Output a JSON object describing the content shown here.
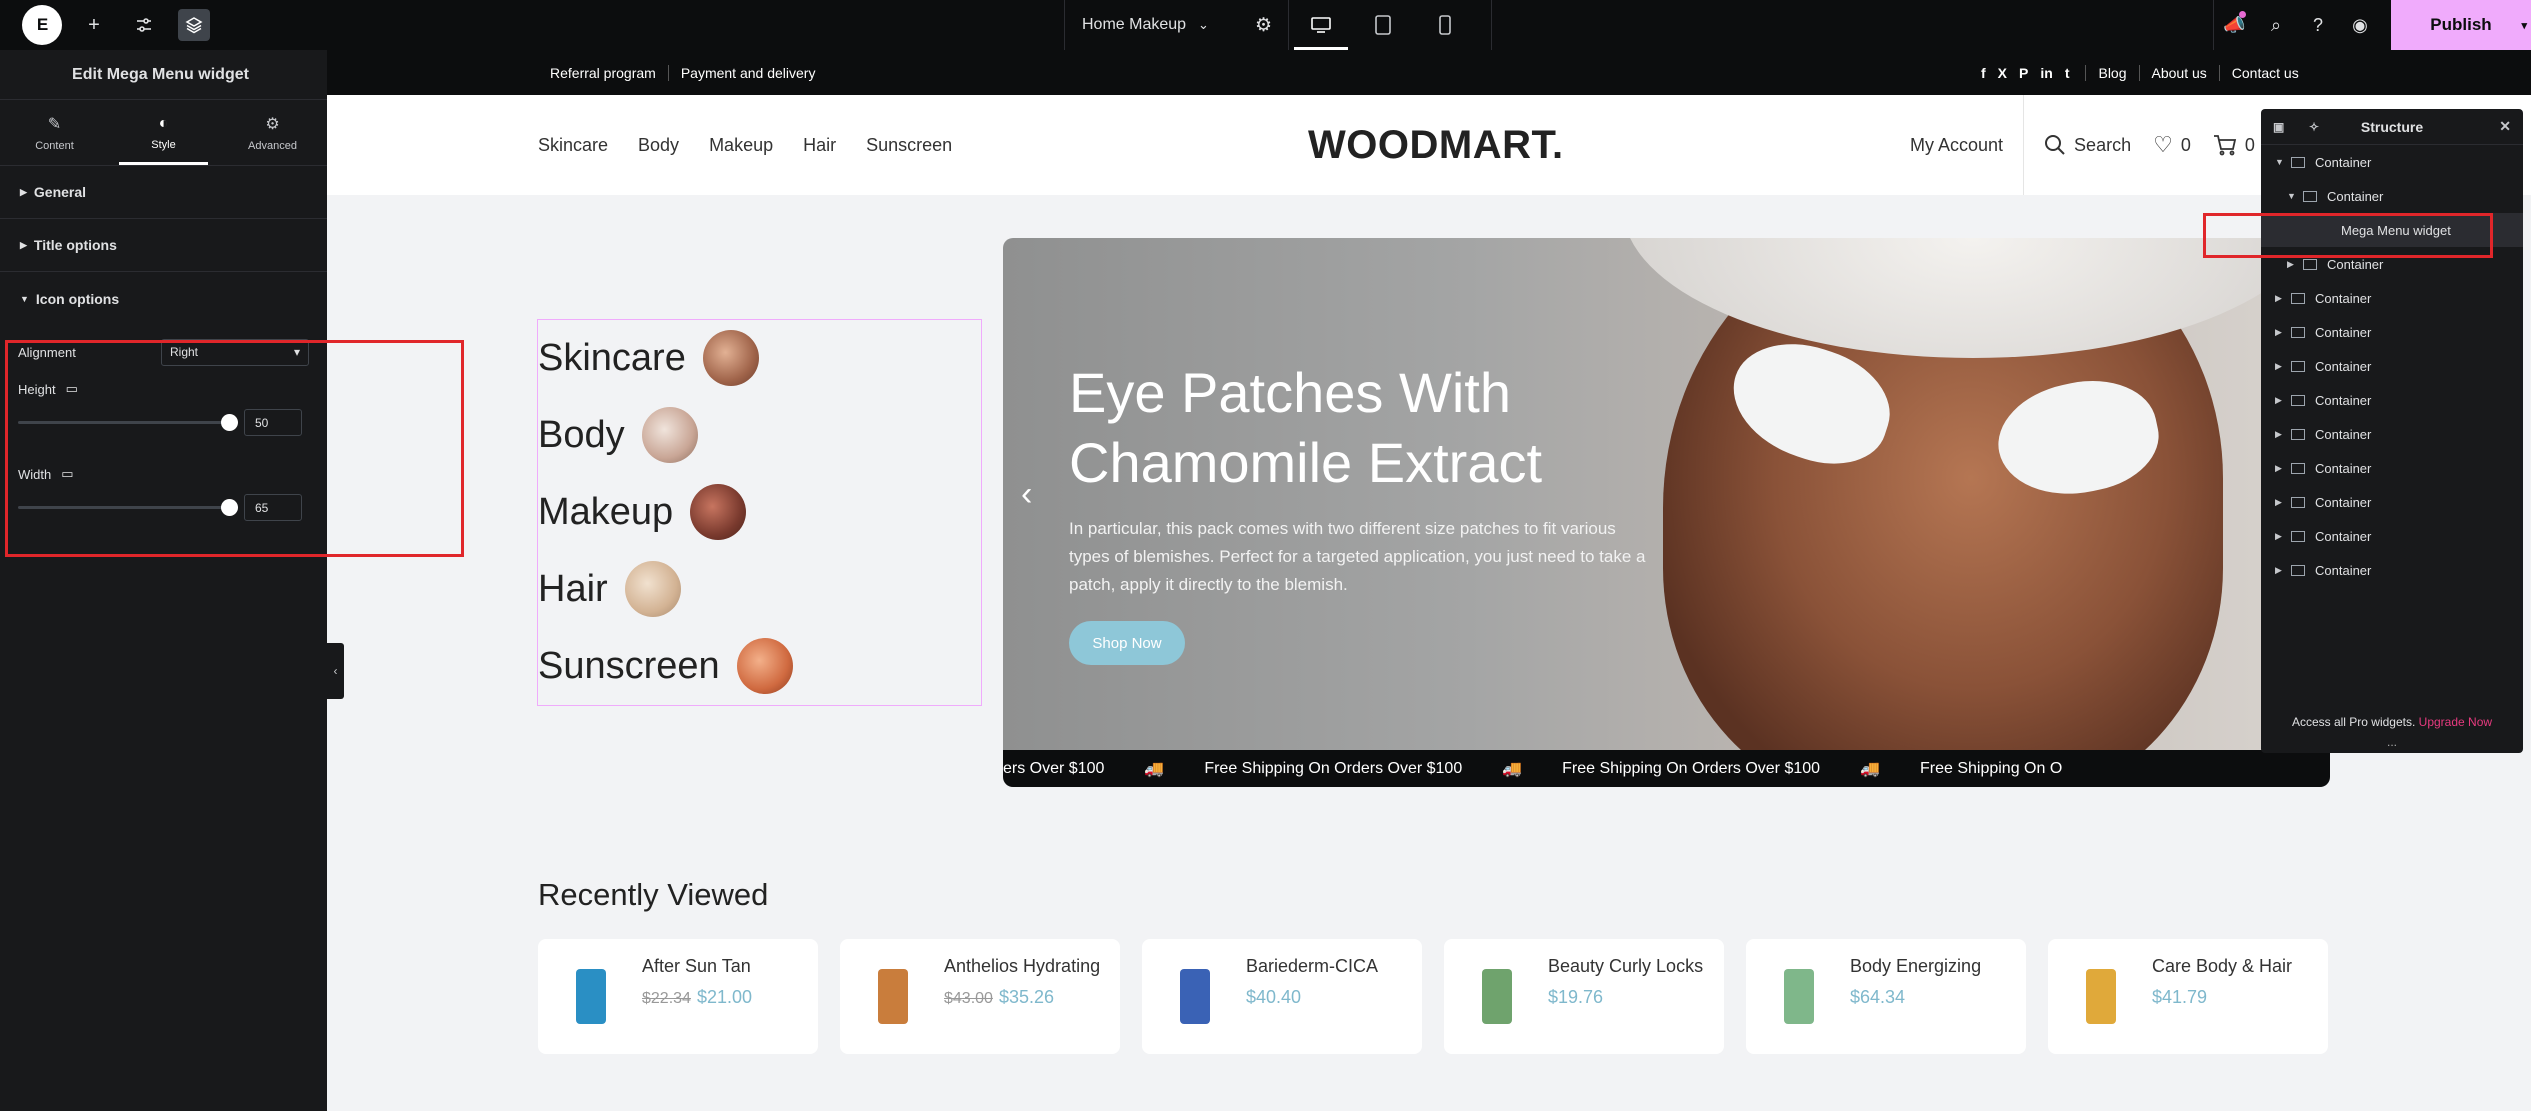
{
  "toolbar": {
    "logo_text": "E",
    "page_name": "Home Makeup",
    "publish_label": "Publish"
  },
  "panel": {
    "title": "Edit Mega Menu widget",
    "tabs": [
      {
        "label": "Content",
        "icon": "pencil-icon"
      },
      {
        "label": "Style",
        "icon": "contrast-icon"
      },
      {
        "label": "Advanced",
        "icon": "gear-icon"
      }
    ],
    "sections": {
      "general": "General",
      "title_options": "Title options",
      "icon_options": "Icon options"
    },
    "alignment_label": "Alignment",
    "alignment_value": "Right",
    "height_label": "Height",
    "height_value": "50",
    "width_label": "Width",
    "width_value": "65"
  },
  "site": {
    "topnav": {
      "left": [
        "Referral program",
        "Payment and delivery"
      ],
      "social": [
        "f",
        "X",
        "P",
        "in",
        "t"
      ],
      "right": [
        "Blog",
        "About us",
        "Contact us"
      ]
    },
    "mainnav": [
      "Skincare",
      "Body",
      "Makeup",
      "Hair",
      "Sunscreen"
    ],
    "brand": "WOODMART.",
    "account_label": "My Account",
    "search_label": "Search",
    "wishlist_count": "0",
    "cart_count": "0",
    "vmenu": [
      "Skincare",
      "Body",
      "Makeup",
      "Hair",
      "Sunscreen"
    ],
    "hero": {
      "title": "Eye Patches With Chamomile Extract",
      "text": "In particular, this pack comes with two different size patches to fit various types of blemishes. Perfect for a targeted application, you just need to take a patch, apply it directly to the blemish.",
      "button": "Shop Now"
    },
    "ticker": [
      "ers Over $100",
      "Free Shipping On Orders Over $100",
      "Free Shipping On Orders Over $100",
      "Free Shipping On O"
    ],
    "recently_viewed_title": "Recently Viewed",
    "products": [
      {
        "name": "After Sun Tan",
        "old_price": "$22.34",
        "price": "$21.00",
        "color": "#2a8fc4"
      },
      {
        "name": "Anthelios Hydrating",
        "old_price": "$43.00",
        "price": "$35.26",
        "color": "#c97d3c"
      },
      {
        "name": "Bariederm-CICA",
        "old_price": "",
        "price": "$40.40",
        "color": "#3a62b5"
      },
      {
        "name": "Beauty Curly Locks",
        "old_price": "",
        "price": "$19.76",
        "color": "#6fa36d"
      },
      {
        "name": "Body Energizing",
        "old_price": "",
        "price": "$64.34",
        "color": "#7fb78a"
      },
      {
        "name": "Care Body & Hair",
        "old_price": "",
        "price": "$41.79",
        "color": "#e0a93a"
      }
    ]
  },
  "structure": {
    "title": "Structure",
    "items": [
      {
        "label": "Container",
        "level": 0,
        "expanded": true
      },
      {
        "label": "Container",
        "level": 1,
        "expanded": true
      },
      {
        "label": "Mega Menu widget",
        "level": 2,
        "expanded": false
      },
      {
        "label": "Container",
        "level": 1,
        "expanded": false
      },
      {
        "label": "Container",
        "level": 0,
        "expanded": false
      },
      {
        "label": "Container",
        "level": 0,
        "expanded": false
      },
      {
        "label": "Container",
        "level": 0,
        "expanded": false
      },
      {
        "label": "Container",
        "level": 0,
        "expanded": false
      },
      {
        "label": "Container",
        "level": 0,
        "expanded": false
      },
      {
        "label": "Container",
        "level": 0,
        "expanded": false
      },
      {
        "label": "Container",
        "level": 0,
        "expanded": false
      },
      {
        "label": "Container",
        "level": 0,
        "expanded": false
      },
      {
        "label": "Container",
        "level": 0,
        "expanded": false
      }
    ],
    "footer_text": "Access all Pro widgets.",
    "upgrade_label": "Upgrade Now",
    "more": "..."
  }
}
